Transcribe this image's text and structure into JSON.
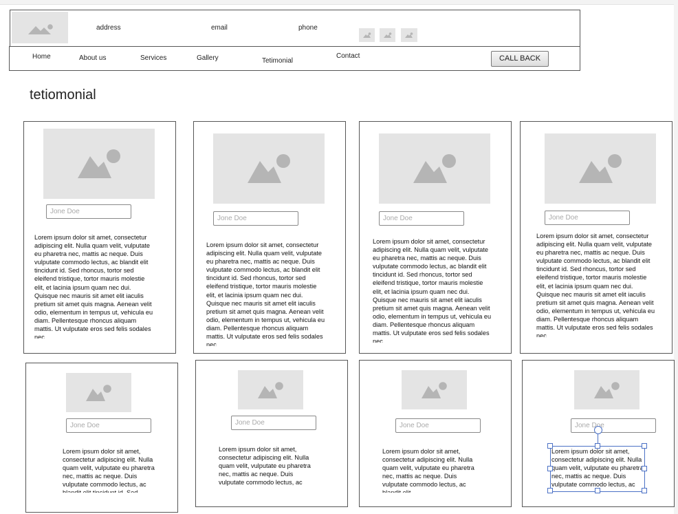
{
  "header": {
    "address": "address",
    "email": "email",
    "phone": "phone",
    "social_icons": [
      "image-icon",
      "image-icon",
      "image-icon"
    ]
  },
  "nav": {
    "items": [
      "Home",
      "About us",
      "Services",
      "Gallery",
      "Tetimonial",
      "Contact"
    ],
    "call_back": "CALL BACK"
  },
  "page": {
    "heading": "tetiomonial"
  },
  "cards": [
    {
      "name_placeholder": "Jone Doe",
      "text": "Lorem ipsum dolor sit amet, consectetur adipiscing elit. Nulla quam velit, vulputate eu pharetra nec, mattis ac neque. Duis vulputate commodo lectus, ac blandit elit tincidunt id. Sed rhoncus, tortor sed eleifend tristique, tortor mauris molestie elit, et lacinia ipsum quam nec dui. Quisque nec mauris sit amet elit iaculis pretium sit amet quis magna. Aenean velit odio, elementum in tempus ut, vehicula eu diam. Pellentesque rhoncus aliquam mattis. Ut vulputate eros sed felis sodales nec"
    },
    {
      "name_placeholder": "Jone Doe",
      "text": "Lorem ipsum dolor sit amet, consectetur adipiscing elit. Nulla quam velit, vulputate eu pharetra nec, mattis ac neque. Duis vulputate commodo lectus, ac blandit elit tincidunt id. Sed rhoncus, tortor sed eleifend tristique, tortor mauris molestie elit, et lacinia ipsum quam nec dui. Quisque nec mauris sit amet elit iaculis pretium sit amet quis magna. Aenean velit odio, elementum in tempus ut, vehicula eu diam. Pellentesque rhoncus aliquam mattis. Ut vulputate eros sed felis sodales nec"
    },
    {
      "name_placeholder": "Jone Doe",
      "text": "Lorem ipsum dolor sit amet, consectetur adipiscing elit. Nulla quam velit, vulputate eu pharetra nec, mattis ac neque. Duis vulputate commodo lectus, ac blandit elit tincidunt id. Sed rhoncus, tortor sed eleifend tristique, tortor mauris molestie elit, et lacinia ipsum quam nec dui. Quisque nec mauris sit amet elit iaculis pretium sit amet quis magna. Aenean velit odio, elementum in tempus ut, vehicula eu diam. Pellentesque rhoncus aliquam mattis. Ut vulputate eros sed felis sodales nec"
    },
    {
      "name_placeholder": "Jone Doe",
      "text": "Lorem ipsum dolor sit amet, consectetur adipiscing elit. Nulla quam velit, vulputate eu pharetra nec, mattis ac neque. Duis vulputate commodo lectus, ac blandit elit tincidunt id. Sed rhoncus, tortor sed eleifend tristique, tortor mauris molestie elit, et lacinia ipsum quam nec dui. Quisque nec mauris sit amet elit iaculis pretium sit amet quis magna. Aenean velit odio, elementum in tempus ut, vehicula eu diam. Pellentesque rhoncus aliquam mattis. Ut vulputate eros sed felis sodales nec"
    },
    {
      "name_placeholder": "Jone Doe",
      "text": "Lorem ipsum dolor sit amet, consectetur adipiscing elit. Nulla quam velit, vulputate eu pharetra nec, mattis ac neque. Duis vulputate commodo lectus, ac blandit elit tincidunt id. Sed rhoncus,"
    },
    {
      "name_placeholder": "Jone Doe",
      "text": "Lorem ipsum dolor sit amet, consectetur adipiscing elit. Nulla quam velit, vulputate eu pharetra nec, mattis ac neque. Duis vulputate commodo lectus, ac blandit elit"
    },
    {
      "name_placeholder": "Jone Doe",
      "text": "Lorem ipsum dolor sit amet, consectetur adipiscing elit. Nulla quam velit, vulputate eu pharetra nec, mattis ac neque. Duis vulputate commodo lectus, ac blandit elit"
    },
    {
      "name_placeholder": "Jone Doe",
      "text": "Lorem ipsum dolor sit amet, consectetur adipiscing elit. Nulla quam velit, vulputate eu pharetra nec, mattis ac neque. Duis vulputate commodo lectus, ac blandit elit"
    }
  ]
}
